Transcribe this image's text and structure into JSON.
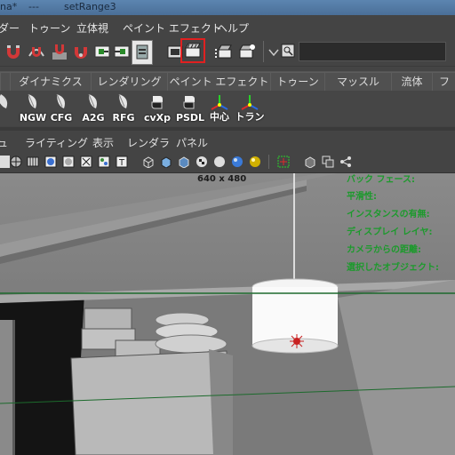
{
  "title_bar": {
    "left_fragment": "na*",
    "separator": "---",
    "scene_name": "setRange3"
  },
  "menu": {
    "items": [
      {
        "id": "lead-cut",
        "label": "ダー"
      },
      {
        "id": "toon",
        "label": "トゥーン"
      },
      {
        "id": "stereo",
        "label": "立体視"
      },
      {
        "id": "paint-effects",
        "label": "ペイント エフェクト"
      },
      {
        "id": "help",
        "label": "ヘルプ"
      }
    ]
  },
  "toolbar": {
    "icons": [
      "magnet-u-icon",
      "magnet-curve-icon",
      "magnet-point-icon",
      "magnet-plane-icon",
      "input-ops-icon",
      "output-ops-icon",
      "construction-history-icon",
      "render-frame-icon",
      "render-current-icon",
      "ipr-render-icon",
      "render-settings-icon",
      "dropdown-icon",
      "search-field-icon"
    ],
    "highlighted": "render-current-icon",
    "highlight_color": "#e02020",
    "search_value": ""
  },
  "shelf_tabs": [
    "ダイナミクス",
    "レンダリング",
    "ペイント エフェクト",
    "トゥーン",
    "マッスル",
    "流体",
    "フ"
  ],
  "shelf_buttons": [
    {
      "label": "",
      "icon": "feather-icon"
    },
    {
      "label": "NGW",
      "icon": "feather-icon"
    },
    {
      "label": "CFG",
      "icon": "feather-icon"
    },
    {
      "label": "A2G",
      "icon": "feather-icon"
    },
    {
      "label": "RFG",
      "icon": "feather-icon"
    },
    {
      "label": "cvXp",
      "icon": "python-icon"
    },
    {
      "label": "PSDL",
      "icon": "python-icon"
    },
    {
      "label": "中心",
      "icon": "axis-gizmo-icon"
    },
    {
      "label": "トラン",
      "icon": "axis-gizmo-icon"
    }
  ],
  "panel_menu": [
    {
      "id": "view",
      "label": "ュ"
    },
    {
      "id": "lighting",
      "label": "ライティング"
    },
    {
      "id": "show",
      "label": "表示"
    },
    {
      "id": "renderer",
      "label": "レンダラ"
    },
    {
      "id": "panels",
      "label": "パネル"
    }
  ],
  "viewport": {
    "resolution": "640 x 480",
    "hud": [
      "バック フェース:",
      "平滑性:",
      "インスタンスの有無:",
      "ディスプレイ レイヤ:",
      "カメラからの距離:",
      "選択したオブジェクト:"
    ],
    "hud_color": "#1c9a2c"
  }
}
